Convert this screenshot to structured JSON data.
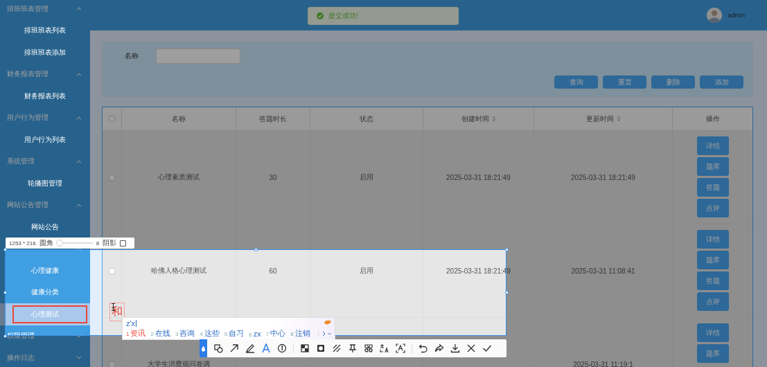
{
  "sidebar": {
    "sections": [
      {
        "label": "排班班表管理",
        "expanded": true,
        "children": [
          {
            "label": "排班班表列表",
            "selected": false
          },
          {
            "label": "排班班表添加",
            "selected": false
          }
        ]
      },
      {
        "label": "财务报表管理",
        "expanded": true,
        "children": [
          {
            "label": "财务报表列表",
            "selected": false
          }
        ]
      },
      {
        "label": "用户行为管理",
        "expanded": true,
        "children": [
          {
            "label": "用户行为列表",
            "selected": false
          }
        ]
      },
      {
        "label": "系统管理",
        "expanded": true,
        "children": [
          {
            "label": "轮播图管理",
            "selected": false
          }
        ]
      },
      {
        "label": "网站公告管理",
        "expanded": true,
        "children": [
          {
            "label": "网站公告",
            "selected": false
          }
        ]
      },
      {
        "expanded": true,
        "children": [
          {
            "label": "心理健康",
            "selected": false
          },
          {
            "label": "健康分类",
            "selected": false
          },
          {
            "label": "心理测试",
            "selected": true
          }
        ]
      },
      {
        "label": "权限管理",
        "expanded": false
      },
      {
        "label": "操作日志",
        "expanded": false
      }
    ]
  },
  "header": {
    "toast": "提交成功!",
    "user": "admin"
  },
  "search": {
    "label": "名称",
    "buttons": [
      "查询",
      "重置",
      "删除",
      "添加"
    ]
  },
  "table": {
    "all_checked": false,
    "columns": [
      {
        "label": "名称",
        "sortable": false
      },
      {
        "label": "答题时长",
        "sortable": false
      },
      {
        "label": "状态",
        "sortable": false
      },
      {
        "label": "创建时间",
        "sortable": true
      },
      {
        "label": "更新时间",
        "sortable": true
      },
      {
        "label": "操作",
        "sortable": false
      }
    ],
    "rows": [
      {
        "checked": false,
        "name": "心理素质测试",
        "duration": "30",
        "status": "启用",
        "created": "2025-03-31 18:21:49",
        "updated": "2025-03-31 18:21:49",
        "actions": [
          "详情",
          "题库",
          "答题",
          "点评"
        ]
      },
      {
        "checked": false,
        "name": "哈佛人格心理测试",
        "duration": "60",
        "status": "启用",
        "created": "2025-03-31 18:21:49",
        "updated": "2025-03-31 11:08:41",
        "actions": [
          "详情",
          "题库",
          "答题",
          "点评"
        ]
      },
      {
        "checked": false,
        "name": "大学生消费观问卷调",
        "updated": "2025-03-31 11:19:1",
        "actions": [
          "详情",
          "题库"
        ]
      }
    ]
  },
  "capture": {
    "size": "1253 * 216",
    "radius_label": "圆角",
    "radius": {
      "level": 0.08,
      "value": "8"
    },
    "shadow_label": "阴影",
    "shadow_checked": false,
    "composing": "和",
    "ime": {
      "input": "z'x",
      "candidates": [
        {
          "index": "1",
          "text": "资讯",
          "selected": true
        },
        {
          "index": "2",
          "text": "在线",
          "selected": false
        },
        {
          "index": "3",
          "text": "咨询",
          "selected": false
        },
        {
          "index": "4",
          "text": "这些",
          "selected": false
        },
        {
          "index": "5",
          "text": "自习",
          "selected": false
        },
        {
          "index": "6",
          "text": "zx",
          "selected": false
        },
        {
          "index": "7",
          "text": "中心",
          "selected": false
        },
        {
          "index": "8",
          "text": "注销",
          "selected": false
        }
      ]
    },
    "tools": [
      {
        "kind": "marker",
        "selected": true
      },
      {
        "kind": "shapes",
        "selected": false
      },
      {
        "kind": "arrow",
        "selected": false
      },
      {
        "kind": "pencil",
        "selected": false
      },
      {
        "kind": "text",
        "selected": false
      },
      {
        "kind": "number",
        "selected": false
      },
      {
        "kind": "separator"
      },
      {
        "kind": "mosaic",
        "selected": false
      },
      {
        "kind": "blur",
        "selected": false
      },
      {
        "kind": "hatch",
        "selected": false
      },
      {
        "kind": "pin",
        "selected": false
      },
      {
        "kind": "cut",
        "selected": false
      },
      {
        "kind": "translate",
        "selected": false
      },
      {
        "kind": "ocr",
        "selected": false
      },
      {
        "kind": "separator"
      },
      {
        "kind": "undo",
        "selected": false
      },
      {
        "kind": "redo",
        "selected": false
      },
      {
        "kind": "download",
        "selected": false
      },
      {
        "kind": "close",
        "selected": false
      },
      {
        "kind": "confirm",
        "selected": false
      }
    ]
  }
}
